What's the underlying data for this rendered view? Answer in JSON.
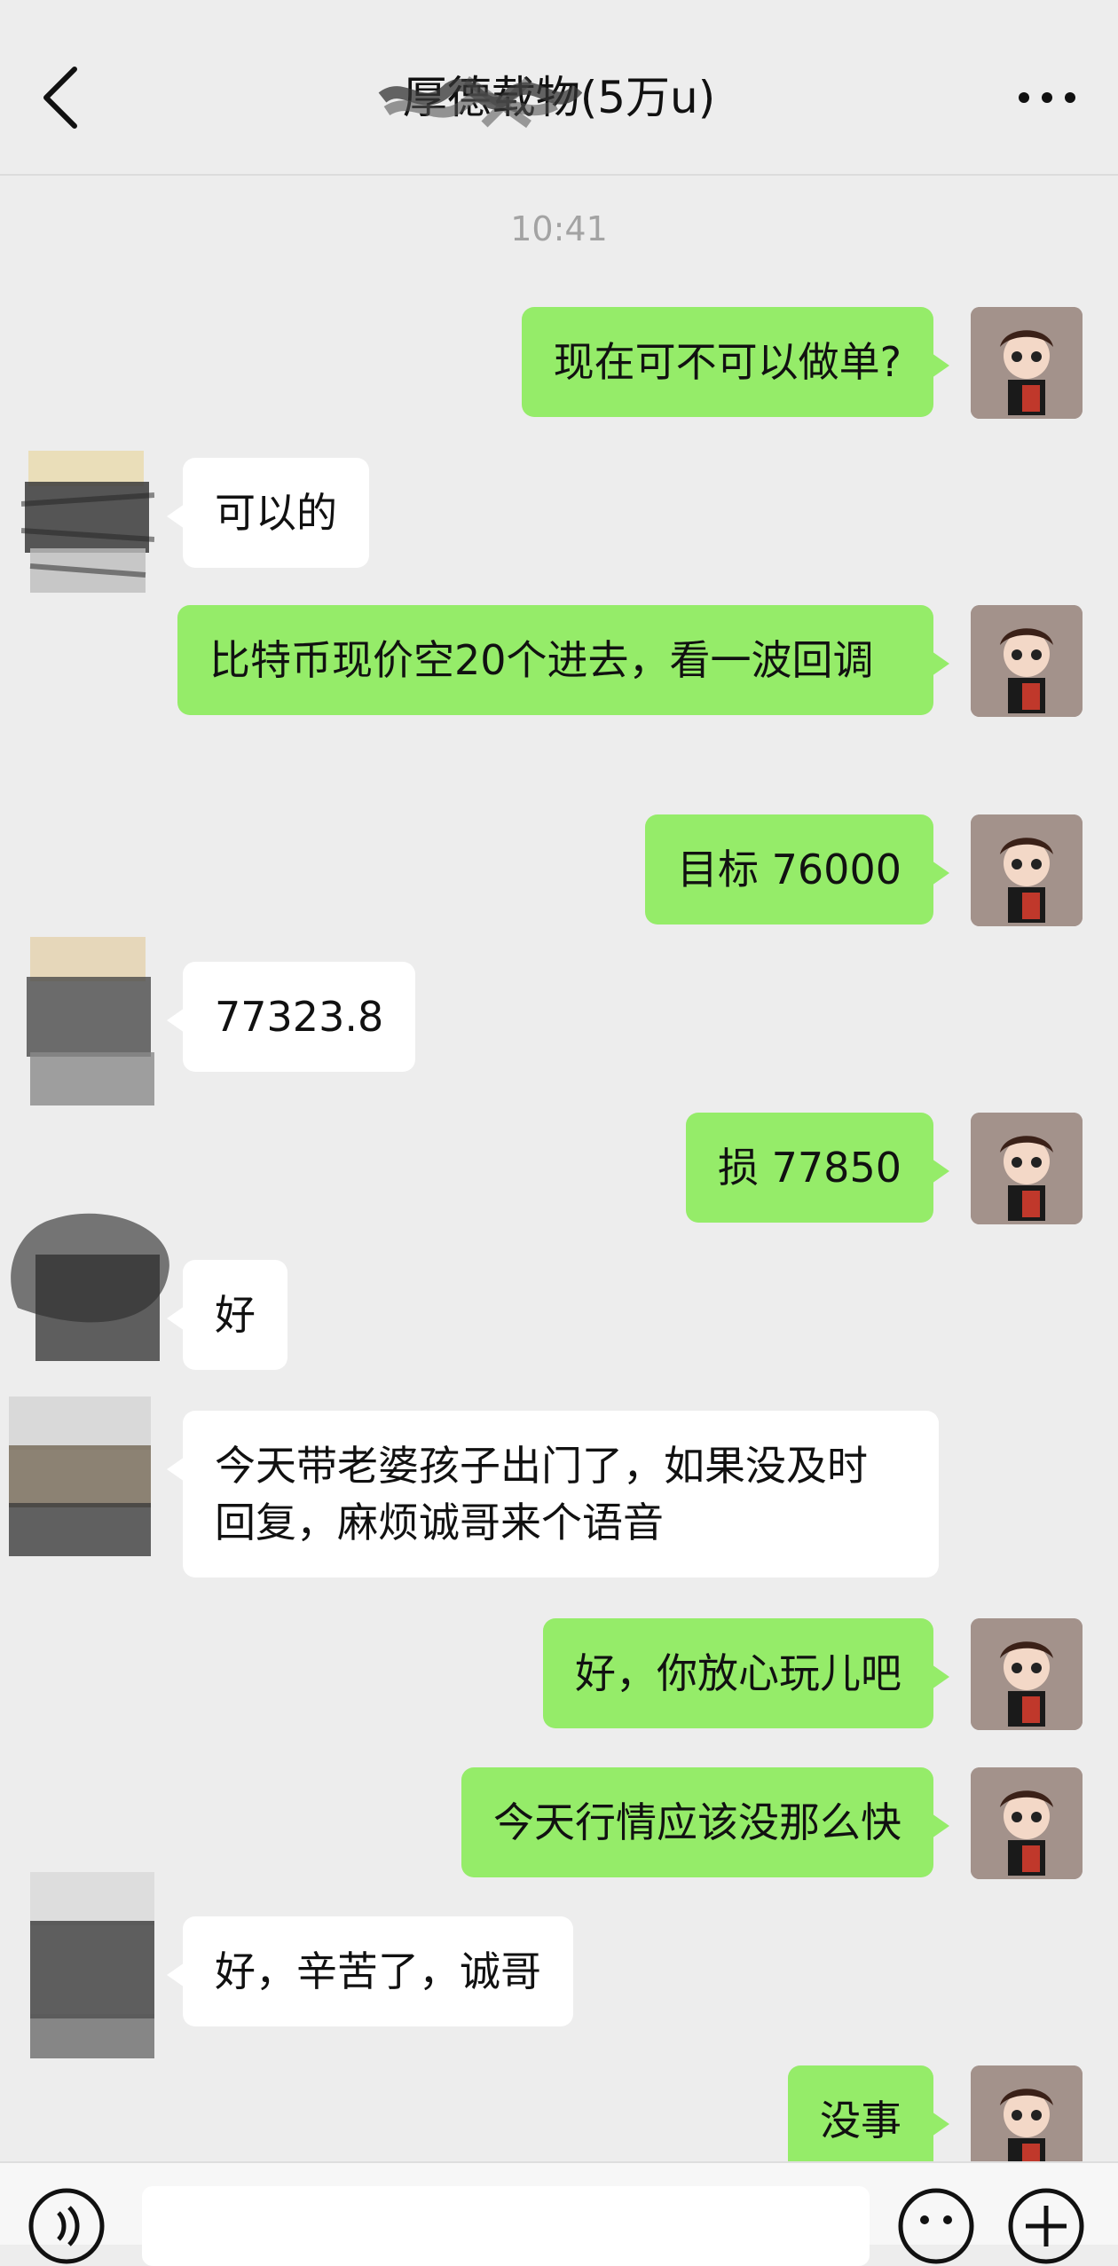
{
  "header": {
    "title": "厚德载物(5万u)",
    "back_icon": "chevron-left-icon",
    "more_icon": "ellipsis-icon"
  },
  "timestamp": "10:41",
  "messages": [
    {
      "side": "me",
      "text": "现在可不可以做单?"
    },
    {
      "side": "other",
      "text": "可以的"
    },
    {
      "side": "me",
      "text": "比特币现价空20个进去，看一波回调"
    },
    {
      "side": "me",
      "text": "目标 76000"
    },
    {
      "side": "other",
      "text": "77323.8"
    },
    {
      "side": "me",
      "text": "损 77850"
    },
    {
      "side": "other",
      "text": "好"
    },
    {
      "side": "other",
      "text": "今天带老婆孩子出门了，如果没及时回复，麻烦诚哥来个语音"
    },
    {
      "side": "me",
      "text": "好，你放心玩儿吧"
    },
    {
      "side": "me",
      "text": "今天行情应该没那么快"
    },
    {
      "side": "other",
      "text": "好，辛苦了，诚哥"
    },
    {
      "side": "me",
      "text": "没事"
    }
  ],
  "input_bar": {
    "voice_icon": "voice-icon",
    "emoji_icon": "emoji-icon",
    "plus_icon": "plus-icon"
  }
}
